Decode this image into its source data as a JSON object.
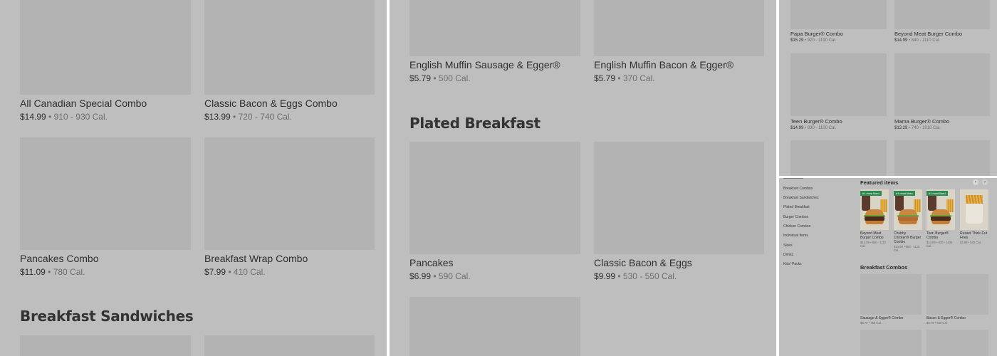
{
  "panel_a": {
    "items": [
      {
        "name": "All Canadian Special Combo",
        "price": "$14.99",
        "cal": "910 - 930 Cal."
      },
      {
        "name": "Classic Bacon & Eggs Combo",
        "price": "$13.99",
        "cal": "720 - 740 Cal."
      },
      {
        "name": "Pancakes Combo",
        "price": "$11.09",
        "cal": "780 Cal."
      },
      {
        "name": "Breakfast Wrap Combo",
        "price": "$7.99",
        "cal": "410 Cal."
      }
    ],
    "section_heading": "Breakfast Sandwiches"
  },
  "panel_b": {
    "top_items": [
      {
        "name": "English Muffin Sausage & Egger®",
        "price": "$5.79",
        "cal": "500 Cal."
      },
      {
        "name": "English Muffin Bacon & Egger®",
        "price": "$5.79",
        "cal": "370 Cal."
      }
    ],
    "section_heading": "Plated Breakfast",
    "items": [
      {
        "name": "Pancakes",
        "price": "$6.99",
        "cal": "590 Cal."
      },
      {
        "name": "Classic Bacon & Eggs",
        "price": "$9.99",
        "cal": "530 - 550 Cal."
      }
    ]
  },
  "panel_c": {
    "items": [
      {
        "name": "Papa Burger® Combo",
        "price": "$15.29",
        "cal": "920 - 1190 Cal."
      },
      {
        "name": "Beyond Meat Burger Combo",
        "price": "$14.99",
        "cal": "840 - 1110 Cal."
      },
      {
        "name": "Teen Burger® Combo",
        "price": "$14.99",
        "cal": "830 - 1100 Cal."
      },
      {
        "name": "Mama Burger® Combo",
        "price": "$13.29",
        "cal": "740 - 1010 Cal."
      }
    ]
  },
  "panel_d": {
    "categories": [
      "Breakfast Combos",
      "Breakfast Sandwiches",
      "Plated Breakfast",
      "Burger Combos",
      "Chicken Combos",
      "Individual Items",
      "Sides",
      "Drinks",
      "Kids' Packs"
    ],
    "featured_heading": "Featured items",
    "arrow_prev": "‹",
    "arrow_next": "›",
    "featured": [
      {
        "badge": "#1 most liked",
        "name": "Beyond Meat Burger Combo",
        "meta": "$14.99 • 840 - 1110 Cal."
      },
      {
        "badge": "#1 most liked",
        "name": "Chubby Chicken® Burger Combo",
        "meta": "$14.99 • 850 - 1120 Cal."
      },
      {
        "badge": "#1 most liked",
        "name": "Teen Burger® Combo",
        "meta": "$14.99 • 830 - 1100 Cal."
      },
      {
        "badge": "",
        "name": "Russet Thick-Cut Fries",
        "meta": "$4.99 • 540 Cal."
      }
    ],
    "section_heading": "Breakfast Combos",
    "combos": [
      {
        "name": "Sausage & Egger® Combo",
        "meta": "$9.79 • 750 Cal."
      },
      {
        "name": "Bacon & Egger® Combo",
        "meta": "$9.79 • 680 Cal."
      }
    ]
  }
}
